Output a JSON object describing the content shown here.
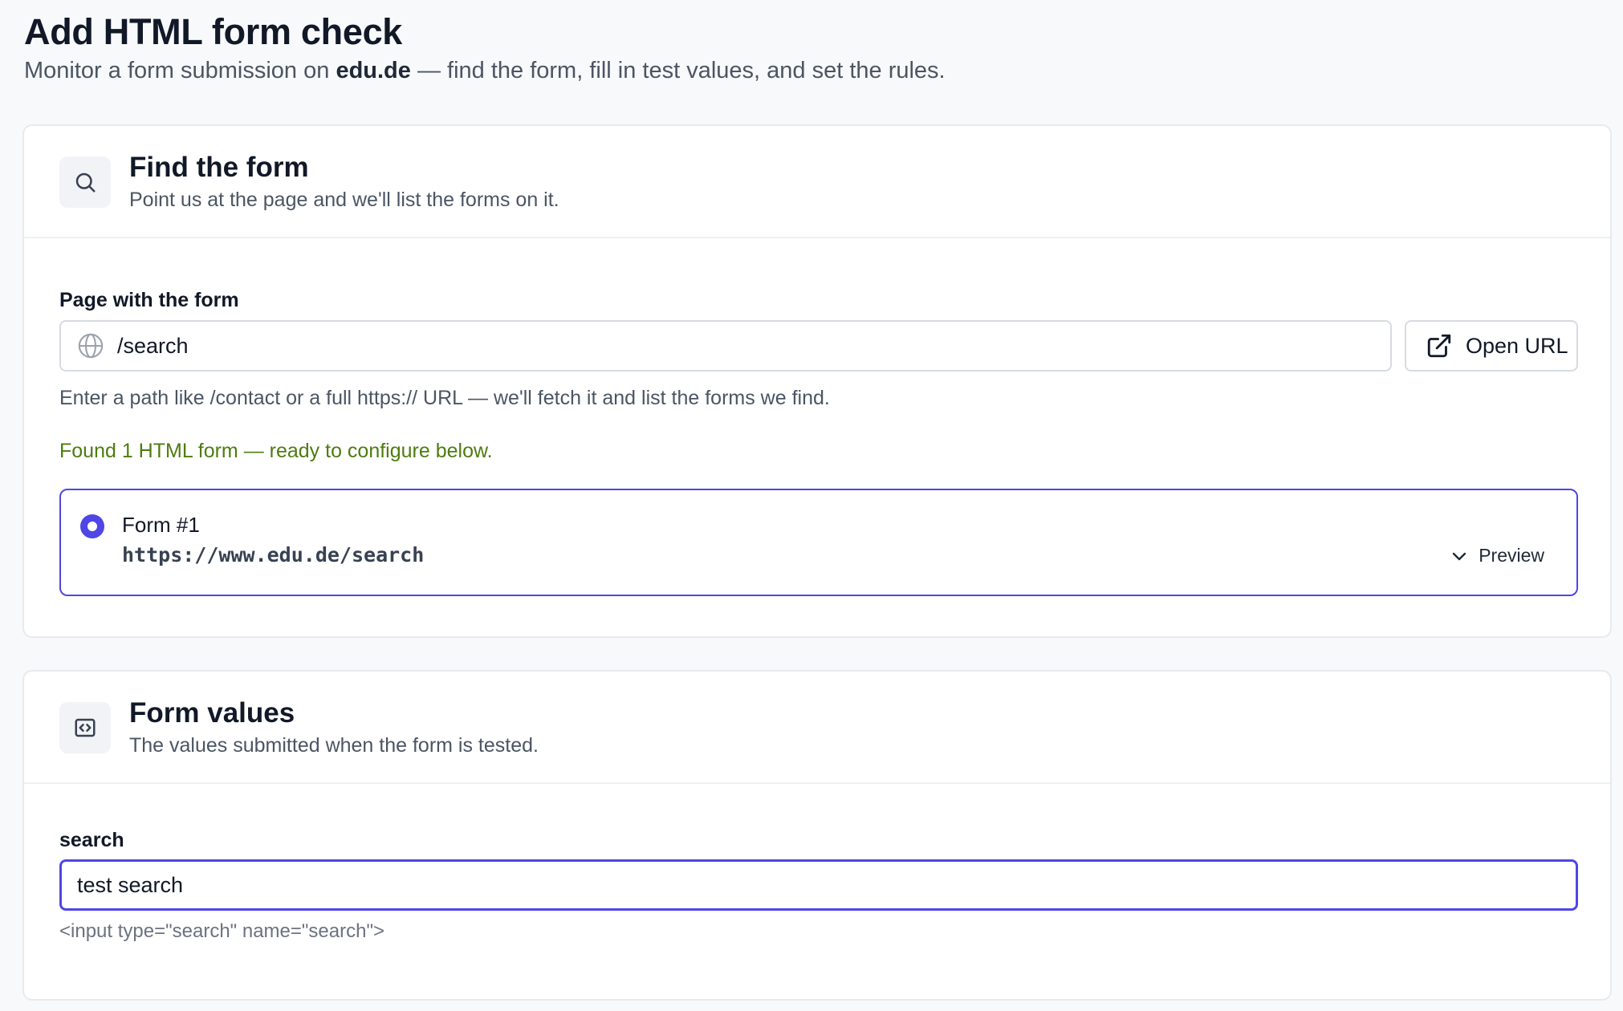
{
  "header": {
    "title": "Add HTML form check",
    "subtitle_prefix": "Monitor a form submission on ",
    "subtitle_domain": "edu.de",
    "subtitle_suffix": " — find the form, fill in test values, and set the rules."
  },
  "find_form": {
    "icon": "search-icon",
    "title": "Find the form",
    "description": "Point us at the page and we'll list the forms on it.",
    "page_label": "Page with the form",
    "page_value": "/search",
    "page_icon": "globe-icon",
    "open_button_label": "Open URL",
    "open_button_icon": "external-link-icon",
    "help_text": "Enter a path like /contact or a full https:// URL — we'll fetch it and list the forms we find.",
    "found_text": "Found 1 HTML form — ready to configure below.",
    "forms": [
      {
        "name": "Form #1",
        "url": "https://www.edu.de/search",
        "selected": true,
        "preview_label": "Preview"
      }
    ]
  },
  "form_values": {
    "icon": "code-icon",
    "title": "Form values",
    "description": "The values submitted when the form is tested.",
    "fields": [
      {
        "label": "search",
        "value": "test search",
        "attributes": "<input type=\"search\" name=\"search\">"
      }
    ]
  },
  "colors": {
    "accent": "#4f46e5",
    "success": "#4d7c0f",
    "background": "#f8f9fb"
  }
}
